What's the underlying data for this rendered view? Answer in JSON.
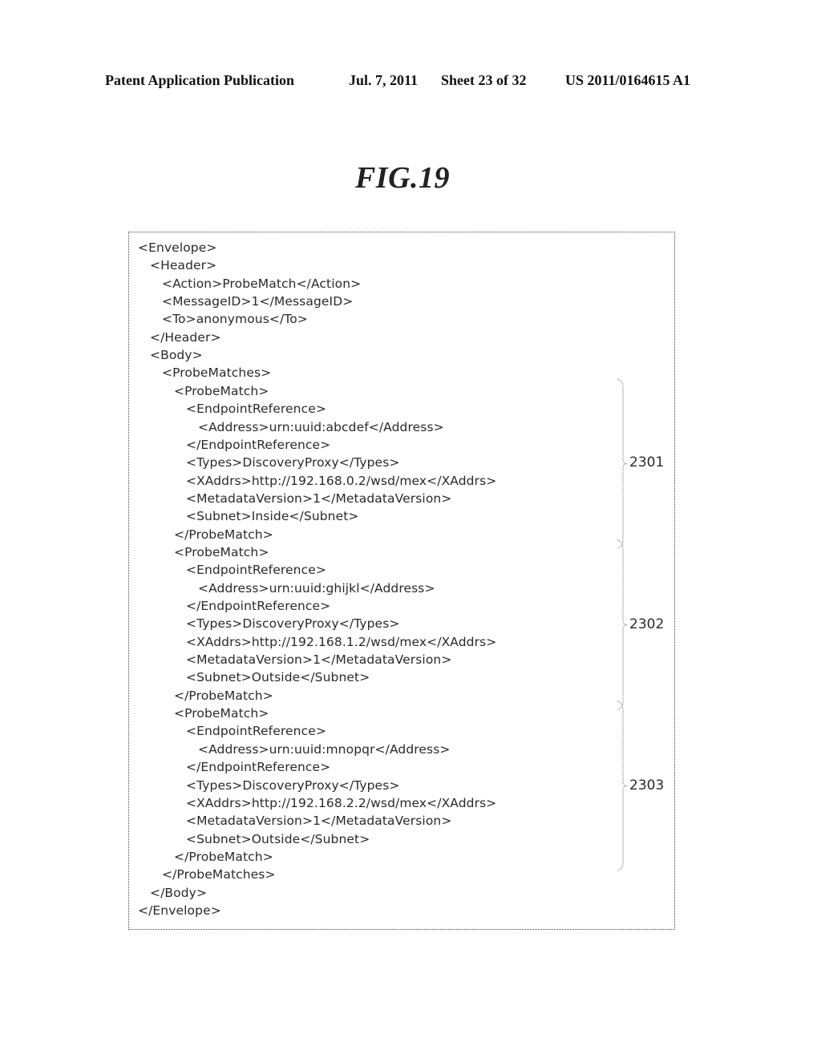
{
  "header": {
    "publication": "Patent Application Publication",
    "date": "Jul. 7, 2011",
    "sheet": "Sheet 23 of 32",
    "number": "US 2011/0164615 A1"
  },
  "figure": {
    "title": "FIG.19"
  },
  "code_lines": [
    {
      "indent": 0,
      "text": "<Envelope>"
    },
    {
      "indent": 1,
      "text": "<Header>"
    },
    {
      "indent": 2,
      "text": "<Action>ProbeMatch</Action>"
    },
    {
      "indent": 2,
      "text": "<MessageID>1</MessageID>"
    },
    {
      "indent": 2,
      "text": "<To>anonymous</To>"
    },
    {
      "indent": 1,
      "text": "</Header>"
    },
    {
      "indent": 1,
      "text": "<Body>"
    },
    {
      "indent": 2,
      "text": "<ProbeMatches>"
    },
    {
      "indent": 3,
      "text": "<ProbeMatch>"
    },
    {
      "indent": 4,
      "text": "<EndpointReference>"
    },
    {
      "indent": 5,
      "text": "<Address>urn:uuid:abcdef</Address>"
    },
    {
      "indent": 4,
      "text": "</EndpointReference>"
    },
    {
      "indent": 4,
      "text": "<Types>DiscoveryProxy</Types>"
    },
    {
      "indent": 4,
      "text": "<XAddrs>http://192.168.0.2/wsd/mex</XAddrs>"
    },
    {
      "indent": 4,
      "text": "<MetadataVersion>1</MetadataVersion>"
    },
    {
      "indent": 4,
      "text": "<Subnet>Inside</Subnet>"
    },
    {
      "indent": 3,
      "text": "</ProbeMatch>"
    },
    {
      "indent": 3,
      "text": "<ProbeMatch>"
    },
    {
      "indent": 4,
      "text": "<EndpointReference>"
    },
    {
      "indent": 5,
      "text": "<Address>urn:uuid:ghijkl</Address>"
    },
    {
      "indent": 4,
      "text": "</EndpointReference>"
    },
    {
      "indent": 4,
      "text": "<Types>DiscoveryProxy</Types>"
    },
    {
      "indent": 4,
      "text": "<XAddrs>http://192.168.1.2/wsd/mex</XAddrs>"
    },
    {
      "indent": 4,
      "text": "<MetadataVersion>1</MetadataVersion>"
    },
    {
      "indent": 4,
      "text": "<Subnet>Outside</Subnet>"
    },
    {
      "indent": 3,
      "text": "</ProbeMatch>"
    },
    {
      "indent": 3,
      "text": "<ProbeMatch>"
    },
    {
      "indent": 4,
      "text": "<EndpointReference>"
    },
    {
      "indent": 5,
      "text": "<Address>urn:uuid:mnopqr</Address>"
    },
    {
      "indent": 4,
      "text": "</EndpointReference>"
    },
    {
      "indent": 4,
      "text": "<Types>DiscoveryProxy</Types>"
    },
    {
      "indent": 4,
      "text": "<XAddrs>http://192.168.2.2/wsd/mex</XAddrs>"
    },
    {
      "indent": 4,
      "text": "<MetadataVersion>1</MetadataVersion>"
    },
    {
      "indent": 4,
      "text": "<Subnet>Outside</Subnet>"
    },
    {
      "indent": 3,
      "text": "</ProbeMatch>"
    },
    {
      "indent": 2,
      "text": "</ProbeMatches>"
    },
    {
      "indent": 1,
      "text": "</Body>"
    },
    {
      "indent": 0,
      "text": "</Envelope>"
    }
  ],
  "references": [
    {
      "label": "2301",
      "first_line": 8,
      "last_line": 16
    },
    {
      "label": "2302",
      "first_line": 17,
      "last_line": 25
    },
    {
      "label": "2303",
      "first_line": 26,
      "last_line": 34
    }
  ]
}
